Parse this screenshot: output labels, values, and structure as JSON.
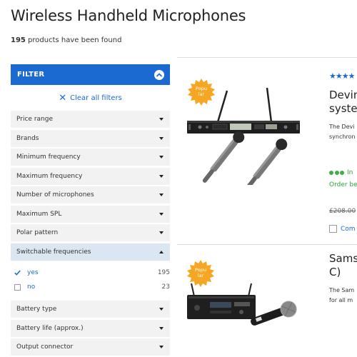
{
  "page": {
    "title": "Wireless Handheld Microphones",
    "results_count": "195",
    "results_suffix": " products have been found"
  },
  "sidebar": {
    "header_label": "FILTER",
    "clear_label": "Clear all filters",
    "facets_top": [
      {
        "label": "Price range"
      },
      {
        "label": "Brands"
      },
      {
        "label": "Minimum frequency"
      },
      {
        "label": "Maximum frequency"
      },
      {
        "label": "Number of microphones"
      },
      {
        "label": "Maximum SPL"
      },
      {
        "label": "Polar pattern"
      }
    ],
    "open_facet": {
      "label": "Switchable frequencies",
      "options": [
        {
          "label": "yes",
          "count": "195",
          "checked": true
        },
        {
          "label": "no",
          "count": "23",
          "checked": false
        }
      ]
    },
    "facets_bottom": [
      {
        "label": "Battery type"
      },
      {
        "label": "Battery life (approx.)"
      },
      {
        "label": "Output connector"
      }
    ]
  },
  "products": [
    {
      "badge": "Popu\nlar",
      "stars": "★★★★",
      "title_line1": "Devin",
      "title_line2": "syste",
      "desc_line1": "The Devi",
      "desc_line2": "synchron",
      "stock": "In",
      "order_note": "Order be",
      "old_price": "£208.00",
      "compare": "Com"
    },
    {
      "badge": "Popu\nlar",
      "title_line1": "Sams",
      "title_line2": "C)",
      "desc_line1": "The Sam",
      "desc_line2": "for all m"
    }
  ],
  "colors": {
    "accent": "#1b6ad1",
    "badge": "#f5a623",
    "stock_green": "#3cb043"
  }
}
